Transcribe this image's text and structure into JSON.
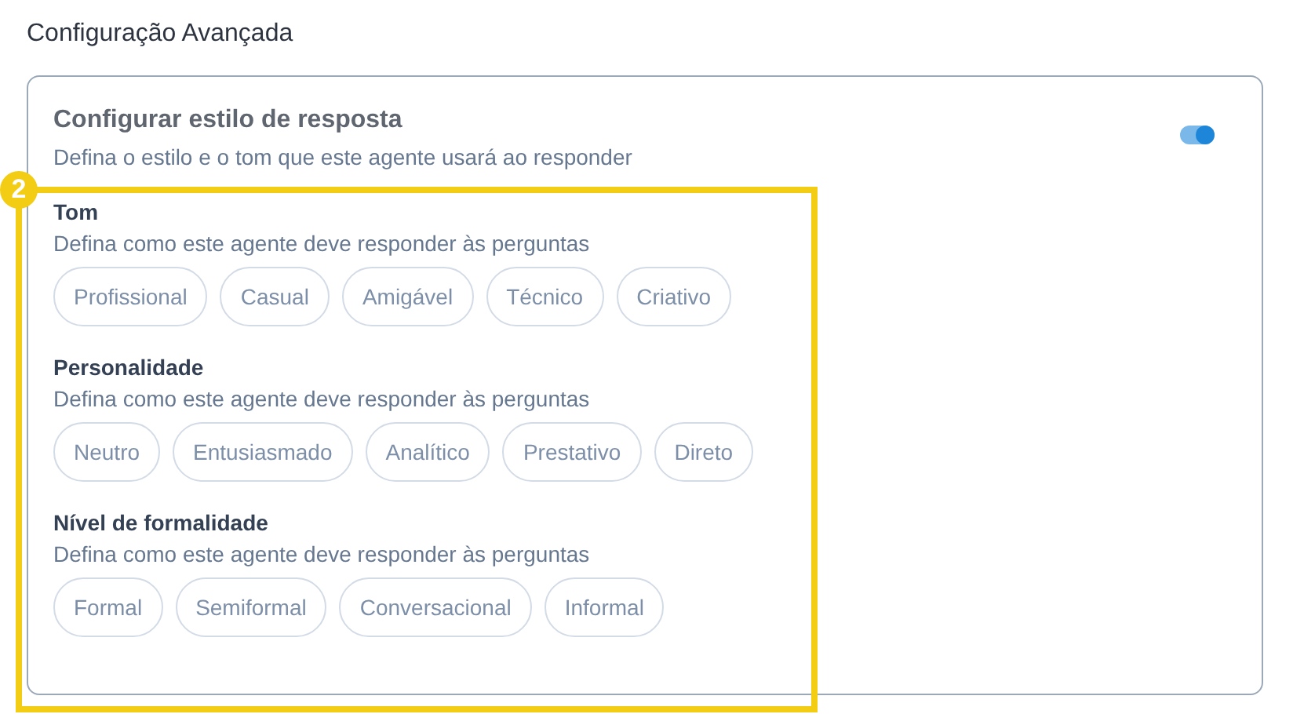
{
  "page_title": "Configuração Avançada",
  "card": {
    "title": "Configurar estilo de resposta",
    "subtitle": "Defina o estilo e o tom que este agente usará ao responder",
    "toggle": {
      "on": true
    },
    "sections": [
      {
        "label": "Tom",
        "hint": "Defina como este agente deve responder às perguntas",
        "options": [
          {
            "label": "Profissional",
            "selected": false
          },
          {
            "label": "Casual",
            "selected": false
          },
          {
            "label": "Amigável",
            "selected": false
          },
          {
            "label": "Técnico",
            "selected": false
          },
          {
            "label": "Criativo",
            "selected": false
          }
        ]
      },
      {
        "label": "Personalidade",
        "hint": "Defina como este agente deve responder às perguntas",
        "options": [
          {
            "label": "Neutro",
            "selected": false
          },
          {
            "label": "Entusiasmado",
            "selected": false
          },
          {
            "label": "Analítico",
            "selected": false
          },
          {
            "label": "Prestativo",
            "selected": false
          },
          {
            "label": "Direto",
            "selected": false
          }
        ]
      },
      {
        "label": "Nível de formalidade",
        "hint": "Defina como este agente deve responder às perguntas",
        "options": [
          {
            "label": "Formal",
            "selected": false
          },
          {
            "label": "Semiformal",
            "selected": false
          },
          {
            "label": "Conversacional",
            "selected": false
          },
          {
            "label": "Informal",
            "selected": false
          }
        ]
      }
    ]
  },
  "annotation": {
    "badge": "2"
  }
}
